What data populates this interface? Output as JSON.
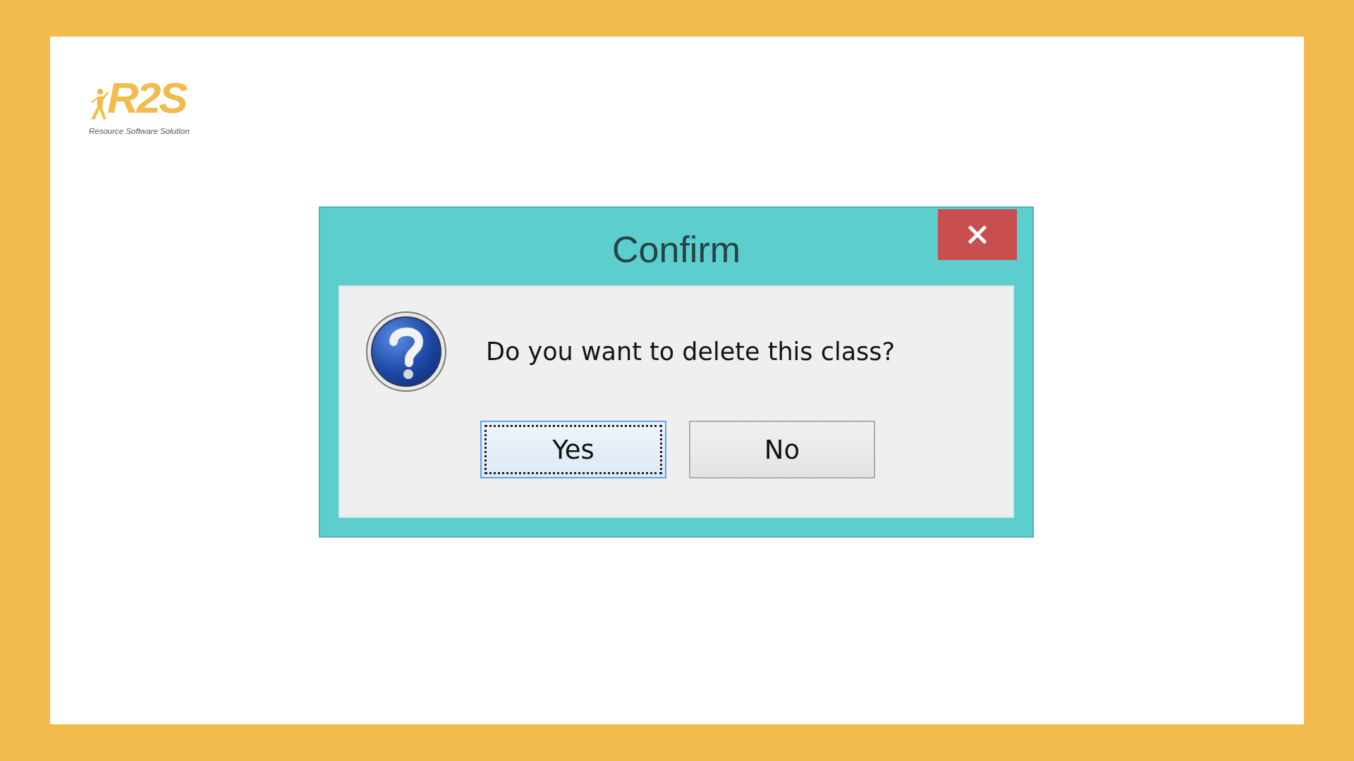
{
  "logo": {
    "text": "R2S",
    "tagline": "Resource Software Solution"
  },
  "dialog": {
    "title": "Confirm",
    "message": "Do you want to delete this class?",
    "buttons": [
      {
        "label": "Yes",
        "focused": true
      },
      {
        "label": "No",
        "focused": false
      }
    ]
  }
}
